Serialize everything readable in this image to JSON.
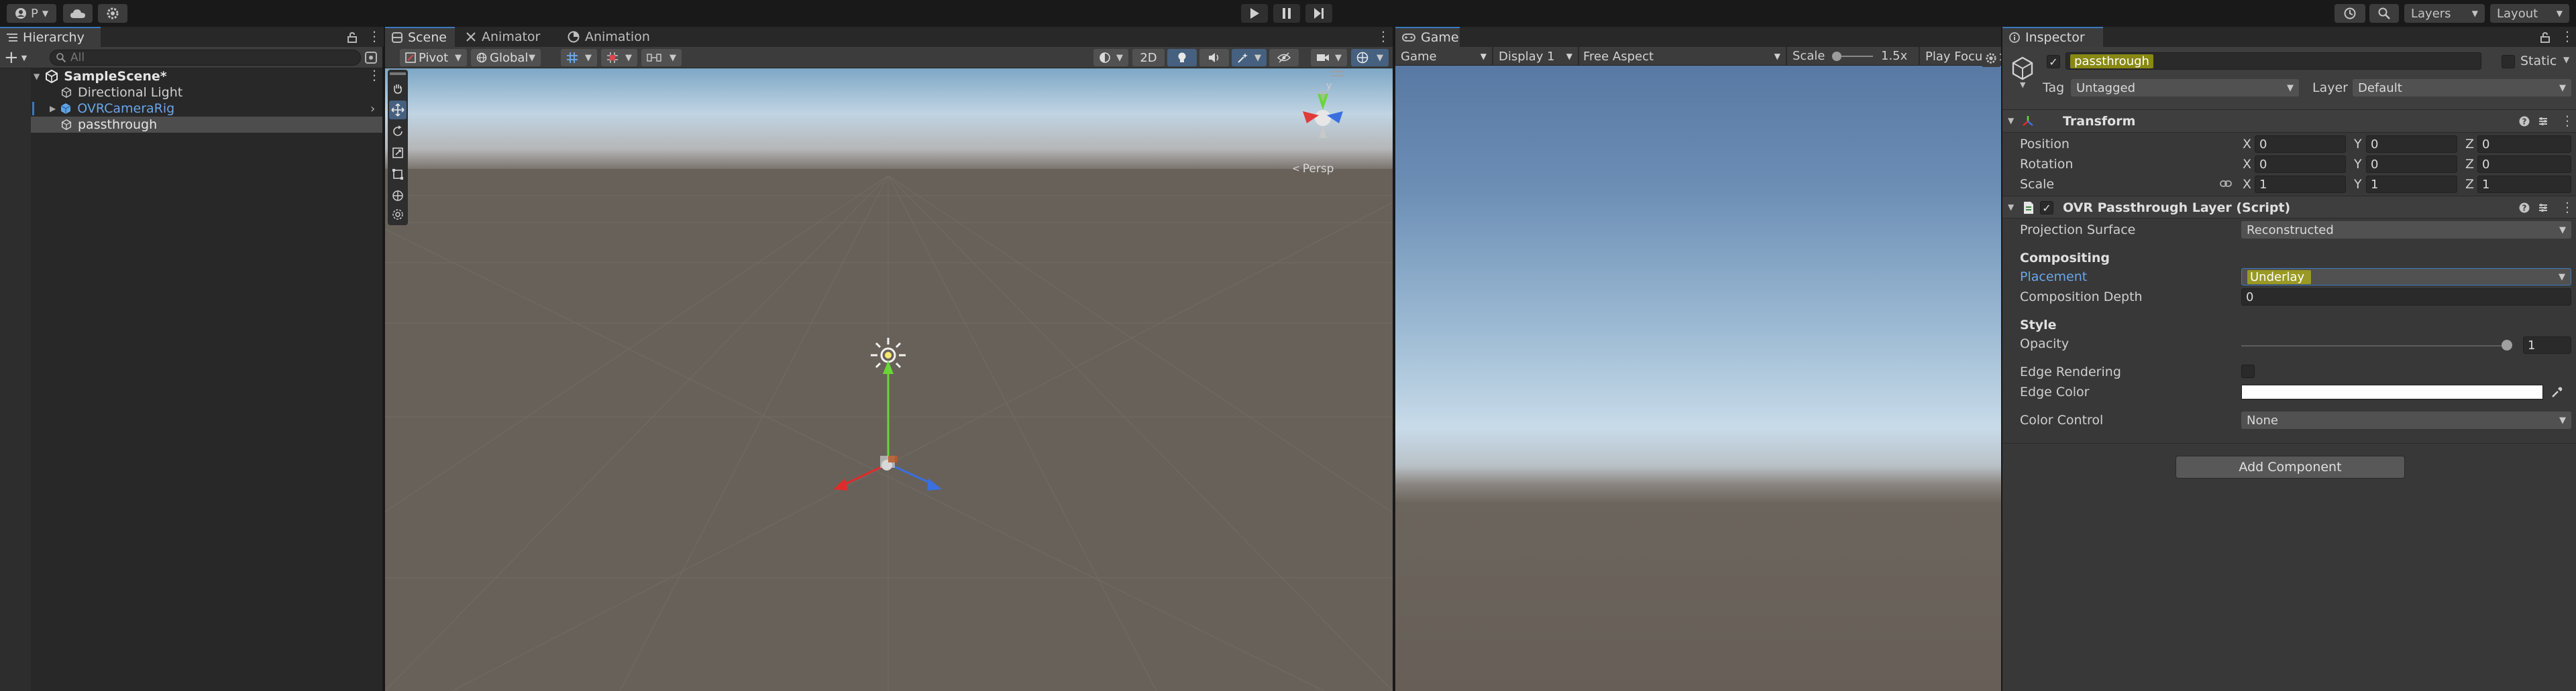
{
  "toolbar": {
    "account_label": "P",
    "layers_label": "Layers",
    "layout_label": "Layout"
  },
  "hierarchy": {
    "tab_label": "Hierarchy",
    "search_placeholder": "All",
    "scene_name": "SampleScene*",
    "items": [
      {
        "label": "Directional Light"
      },
      {
        "label": "OVRCameraRig"
      },
      {
        "label": "passthrough"
      }
    ]
  },
  "scene_view": {
    "tabs": [
      {
        "label": "Scene"
      },
      {
        "label": "Animator"
      },
      {
        "label": "Animation"
      }
    ],
    "pivot_label": "Pivot",
    "global_label": "Global",
    "mode_2d_label": "2D",
    "persp_label": "Persp"
  },
  "game_view": {
    "tab_label": "Game",
    "game_dropdown": "Game",
    "display_dropdown": "Display 1",
    "aspect_dropdown": "Free Aspect",
    "scale_label": "Scale",
    "scale_value": "1.5x",
    "scale_fraction": 0.1,
    "play_mode_dropdown": "Play Focused"
  },
  "inspector": {
    "tab_label": "Inspector",
    "object_name": "passthrough",
    "static_label": "Static",
    "tag_label": "Tag",
    "tag_value": "Untagged",
    "layer_label": "Layer",
    "layer_value": "Default",
    "transform": {
      "title": "Transform",
      "position_label": "Position",
      "rotation_label": "Rotation",
      "scale_label": "Scale",
      "axes": [
        "X",
        "Y",
        "Z"
      ],
      "position": [
        "0",
        "0",
        "0"
      ],
      "rotation": [
        "0",
        "0",
        "0"
      ],
      "scale": [
        "1",
        "1",
        "1"
      ]
    },
    "passthrough_layer": {
      "title": "OVR Passthrough Layer (Script)",
      "projection_surface_label": "Projection Surface",
      "projection_surface_value": "Reconstructed",
      "compositing_header": "Compositing",
      "placement_label": "Placement",
      "placement_value": "Underlay",
      "composition_depth_label": "Composition Depth",
      "composition_depth_value": "0",
      "style_header": "Style",
      "opacity_label": "Opacity",
      "opacity_value": "1",
      "opacity_fraction": 1.0,
      "edge_rendering_label": "Edge Rendering",
      "edge_color_label": "Edge Color",
      "edge_color_value": "#ffffff",
      "color_control_label": "Color Control",
      "color_control_value": "None"
    },
    "add_component_label": "Add Component"
  },
  "colors": {
    "accent_blue": "#3a79bb",
    "highlight_yellow": "#d6d600",
    "x_axis_red": "#e02b2b",
    "y_axis_green": "#6ad635",
    "z_axis_blue": "#3a6fe0"
  }
}
